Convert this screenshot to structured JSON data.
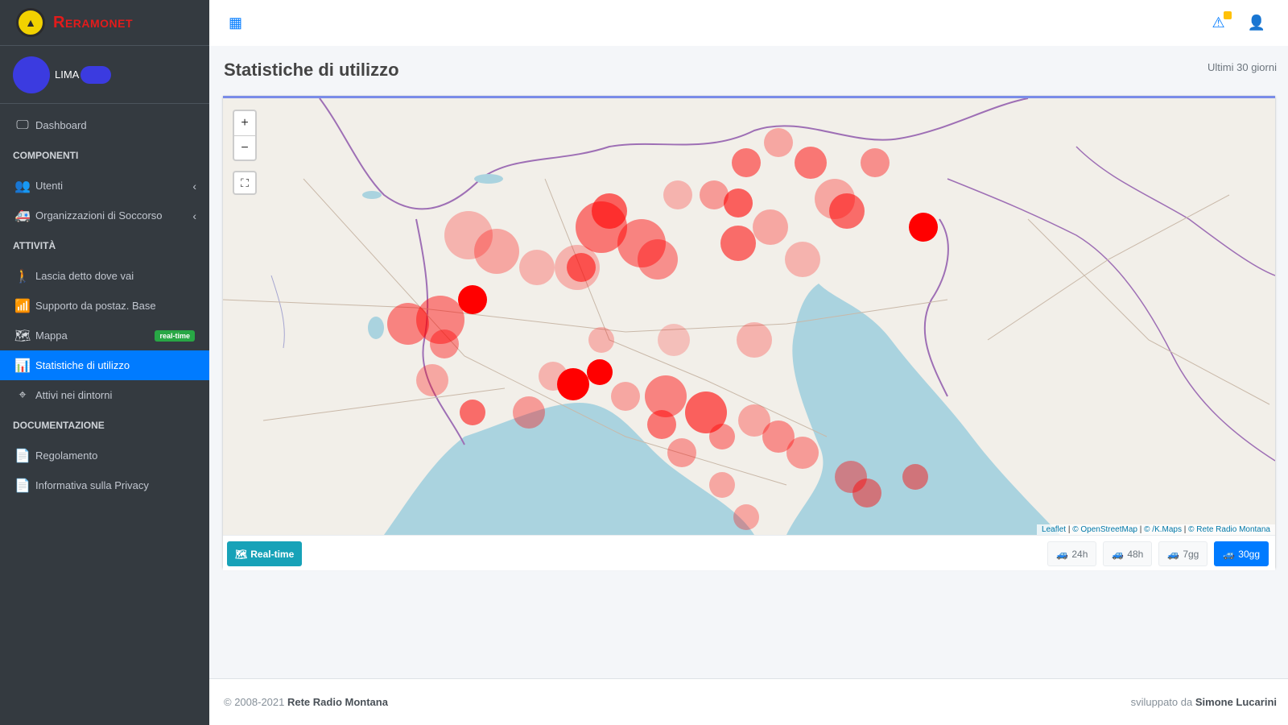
{
  "brand": {
    "name": "Reramonet"
  },
  "user": {
    "name": "LIMA"
  },
  "sidebar": {
    "dashboard": "Dashboard",
    "headers": {
      "components": "COMPONENTI",
      "activity": "ATTIVITÀ",
      "docs": "DOCUMENTAZIONE"
    },
    "items": [
      {
        "label": "Utenti",
        "icon": "users-icon"
      },
      {
        "label": "Organizzazioni di Soccorso",
        "icon": "ambulance-icon"
      },
      {
        "label": "Lascia detto dove vai",
        "icon": "hiker-icon"
      },
      {
        "label": "Supporto da postaz. Base",
        "icon": "wifi-icon"
      },
      {
        "label": "Mappa",
        "icon": "map-icon",
        "badge": "real-time"
      },
      {
        "label": "Statistiche di utilizzo",
        "icon": "chart-icon",
        "active": true
      },
      {
        "label": "Attivi nei dintorni",
        "icon": "crosshair-icon"
      },
      {
        "label": "Regolamento",
        "icon": "document-icon"
      },
      {
        "label": "Informativa sulla Privacy",
        "icon": "document-icon"
      }
    ]
  },
  "content": {
    "title": "Statistiche di utilizzo",
    "period": "Ultimi 30 giorni"
  },
  "map": {
    "zoom_in": "+",
    "zoom_out": "−",
    "fullscreen": "⛶",
    "attribution": [
      "Leaflet",
      "© OpenStreetMap",
      "© /K.Maps",
      "© Rete Radio Montana"
    ],
    "heat_color": "#ff0000"
  },
  "footer_buttons": {
    "realtime": "Real-time",
    "ranges": [
      "24h",
      "48h",
      "7gg",
      "30gg"
    ],
    "active_range": "30gg"
  },
  "footer": {
    "copyright": "© 2008-2021",
    "org": "Rete Radio Montana",
    "dev_prefix": "sviluppato da",
    "dev": "Simone Lucarini"
  }
}
